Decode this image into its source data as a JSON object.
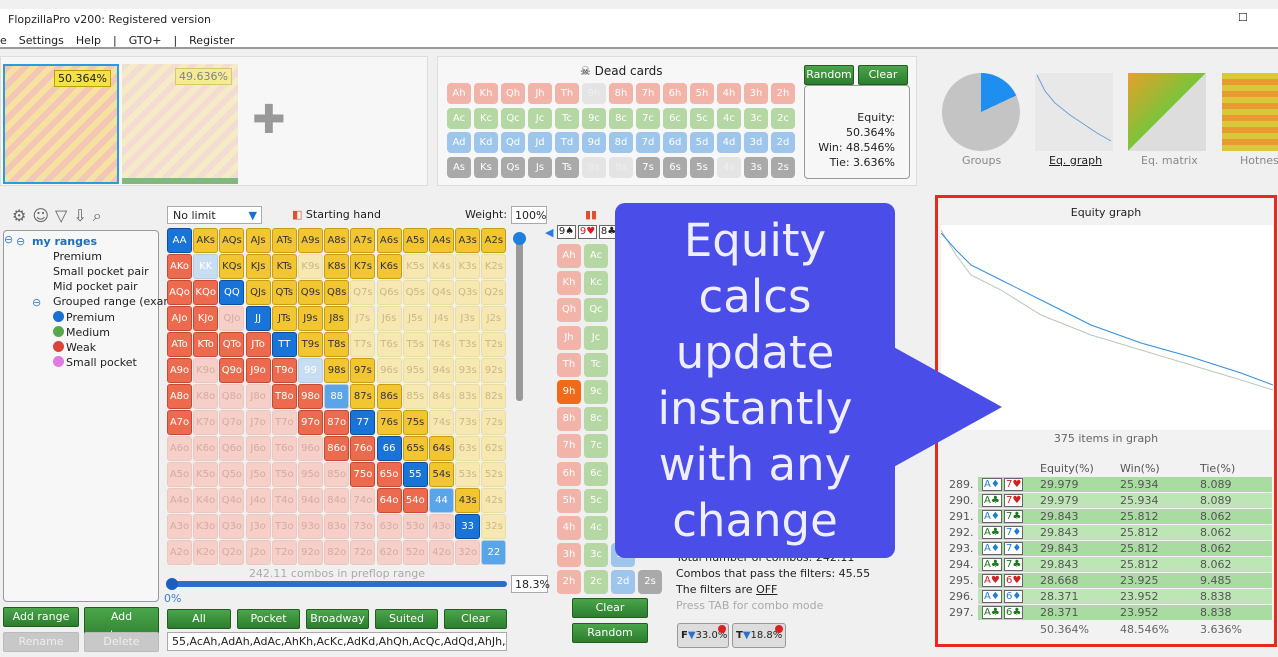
{
  "window": {
    "title": "FlopzillaPro v200: Registered version"
  },
  "menu": [
    "e",
    "Settings",
    "Help",
    "|",
    "GTO+",
    "|",
    "Register"
  ],
  "ranges": [
    {
      "equity": "50.364%"
    },
    {
      "equity": "49.636%"
    }
  ],
  "dead_cards": {
    "title": "Dead cards",
    "random": "Random",
    "clear": "Clear",
    "rows": [
      [
        "Ah",
        "Kh",
        "Qh",
        "Jh",
        "Th",
        "9h",
        "8h",
        "7h",
        "6h",
        "5h",
        "4h",
        "3h",
        "2h"
      ],
      [
        "Ac",
        "Kc",
        "Qc",
        "Jc",
        "Tc",
        "9c",
        "8c",
        "7c",
        "6c",
        "5c",
        "4c",
        "3c",
        "2c"
      ],
      [
        "Ad",
        "Kd",
        "Qd",
        "Jd",
        "Td",
        "9d",
        "8d",
        "7d",
        "6d",
        "5d",
        "4d",
        "3d",
        "2d"
      ],
      [
        "As",
        "Ks",
        "Qs",
        "Js",
        "Ts",
        "9s",
        "8s",
        "7s",
        "6s",
        "5s",
        "4s",
        "3s",
        "2s"
      ]
    ],
    "dimmed": [
      "9h",
      "9s",
      "8s",
      "4s"
    ]
  },
  "equity_box": {
    "equity": "Equity: 50.364%",
    "win": "Win: 48.546%",
    "tie": "Tie: 3.636%"
  },
  "views": [
    "Groups",
    "Eq. graph",
    "Eq. matrix",
    "Hotness"
  ],
  "tree": {
    "root": "my ranges",
    "items": [
      "Premium",
      "Small pocket pair",
      "Mid pocket pair",
      "Grouped range (exar"
    ],
    "groups": [
      {
        "label": "Premium",
        "color": "#1a6fd0"
      },
      {
        "label": "Medium",
        "color": "#5aa64a"
      },
      {
        "label": "Weak",
        "color": "#d9453a"
      },
      {
        "label": "Small pocket",
        "color": "#e07be0"
      }
    ]
  },
  "range_editor": {
    "limit": "No limit",
    "starting_hand": "Starting hand",
    "weight_label": "Weight:",
    "weight": "100%",
    "ranks": [
      "A",
      "K",
      "Q",
      "J",
      "T",
      "9",
      "8",
      "7",
      "6",
      "5",
      "4",
      "3",
      "2"
    ],
    "selected": [
      "AA",
      "AKs",
      "AQs",
      "AJs",
      "ATs",
      "A9s",
      "A8s",
      "A7s",
      "A6s",
      "A5s",
      "A4s",
      "A3s",
      "A2s",
      "AKo",
      "KQs",
      "KJs",
      "KTs",
      "K8s",
      "K7s",
      "K6s",
      "AQo",
      "KQo",
      "QQ",
      "QJs",
      "QTs",
      "Q9s",
      "Q8s",
      "AJo",
      "KJo",
      "JJ",
      "JTs",
      "J9s",
      "J8s",
      "ATo",
      "KTo",
      "QTo",
      "JTo",
      "TT",
      "T9s",
      "T8s",
      "A9o",
      "Q9o",
      "J9o",
      "T9o",
      "98s",
      "97s",
      "A8o",
      "T8o",
      "98o",
      "87s",
      "86s",
      "A7o",
      "97o",
      "87o",
      "77",
      "76s",
      "75s",
      "86o",
      "76o",
      "66",
      "65s",
      "64s",
      "75o",
      "65o",
      "55",
      "54s",
      "64o",
      "54o",
      "43s",
      "33"
    ],
    "medium_pairs": [
      "88",
      "44",
      "22"
    ],
    "combos": "242.11 combos in preflop range",
    "slider_min": "0%",
    "slider_value": "18.3%",
    "buttons": [
      "All",
      "Pocket",
      "Broadway",
      "Suited",
      "Clear"
    ],
    "range_text": "55,AcAh,AdAh,AdAc,AhKh,AcKc,AdKd,AhQh,AcQc,AdQd,AhJh,Ac"
  },
  "left_buttons": {
    "add_range": "Add range",
    "add_category": "Add category",
    "rename": "Rename",
    "delete": "Delete"
  },
  "board": {
    "cards": [
      "9♠",
      "9♥",
      "8♣"
    ],
    "selected": "9h",
    "rows": [
      [
        "Ah",
        "Ac"
      ],
      [
        "Kh",
        "Kc"
      ],
      [
        "Qh",
        "Qc"
      ],
      [
        "Jh",
        "Jc"
      ],
      [
        "Th",
        "Tc"
      ],
      [
        "9h",
        "9c"
      ],
      [
        "8h",
        "8c"
      ],
      [
        "7h",
        "7c"
      ],
      [
        "6h",
        "6c"
      ],
      [
        "5h",
        "5c"
      ],
      [
        "4h",
        "4c"
      ],
      [
        "3h",
        "3c",
        "3d"
      ],
      [
        "2h",
        "2c",
        "2d",
        "2s"
      ]
    ],
    "clear": "Clear",
    "random": "Random"
  },
  "filters": {
    "total": "Total number of combos: 242.11",
    "pass": "Combos that pass the filters: 45.55",
    "off_prefix": "The filters are ",
    "off": "OFF",
    "hint": "Press TAB for combo mode",
    "f_pct": "33.0%",
    "t_pct": "18.8%",
    "f": "F",
    "t": "T"
  },
  "equity_graph": {
    "title": "Equity graph",
    "count": "375 items in graph",
    "headers": [
      "Equity(%)",
      "Win(%)",
      "Tie(%)"
    ],
    "rows": [
      {
        "n": "289.",
        "c1": "A♦",
        "c2": "7♥",
        "eq": "29.979",
        "win": "25.934",
        "tie": "8.089"
      },
      {
        "n": "290.",
        "c1": "A♣",
        "c2": "7♥",
        "eq": "29.979",
        "win": "25.934",
        "tie": "8.089"
      },
      {
        "n": "291.",
        "c1": "A♦",
        "c2": "7♣",
        "eq": "29.843",
        "win": "25.812",
        "tie": "8.062"
      },
      {
        "n": "292.",
        "c1": "A♣",
        "c2": "7♦",
        "eq": "29.843",
        "win": "25.812",
        "tie": "8.062"
      },
      {
        "n": "293.",
        "c1": "A♦",
        "c2": "7♦",
        "eq": "29.843",
        "win": "25.812",
        "tie": "8.062"
      },
      {
        "n": "294.",
        "c1": "A♣",
        "c2": "7♣",
        "eq": "29.843",
        "win": "25.812",
        "tie": "8.062"
      },
      {
        "n": "295.",
        "c1": "A♥",
        "c2": "6♥",
        "eq": "28.668",
        "win": "23.925",
        "tie": "9.485"
      },
      {
        "n": "296.",
        "c1": "A♦",
        "c2": "6♦",
        "eq": "28.371",
        "win": "23.952",
        "tie": "8.838"
      },
      {
        "n": "297.",
        "c1": "A♣",
        "c2": "6♣",
        "eq": "28.371",
        "win": "23.952",
        "tie": "8.838"
      }
    ],
    "totals": [
      "50.364%",
      "48.546%",
      "3.636%"
    ]
  },
  "overlay": {
    "lines": [
      "Equity",
      "calcs",
      "update",
      "instantly",
      "with any",
      "change"
    ],
    "color": "#4b4de8"
  }
}
